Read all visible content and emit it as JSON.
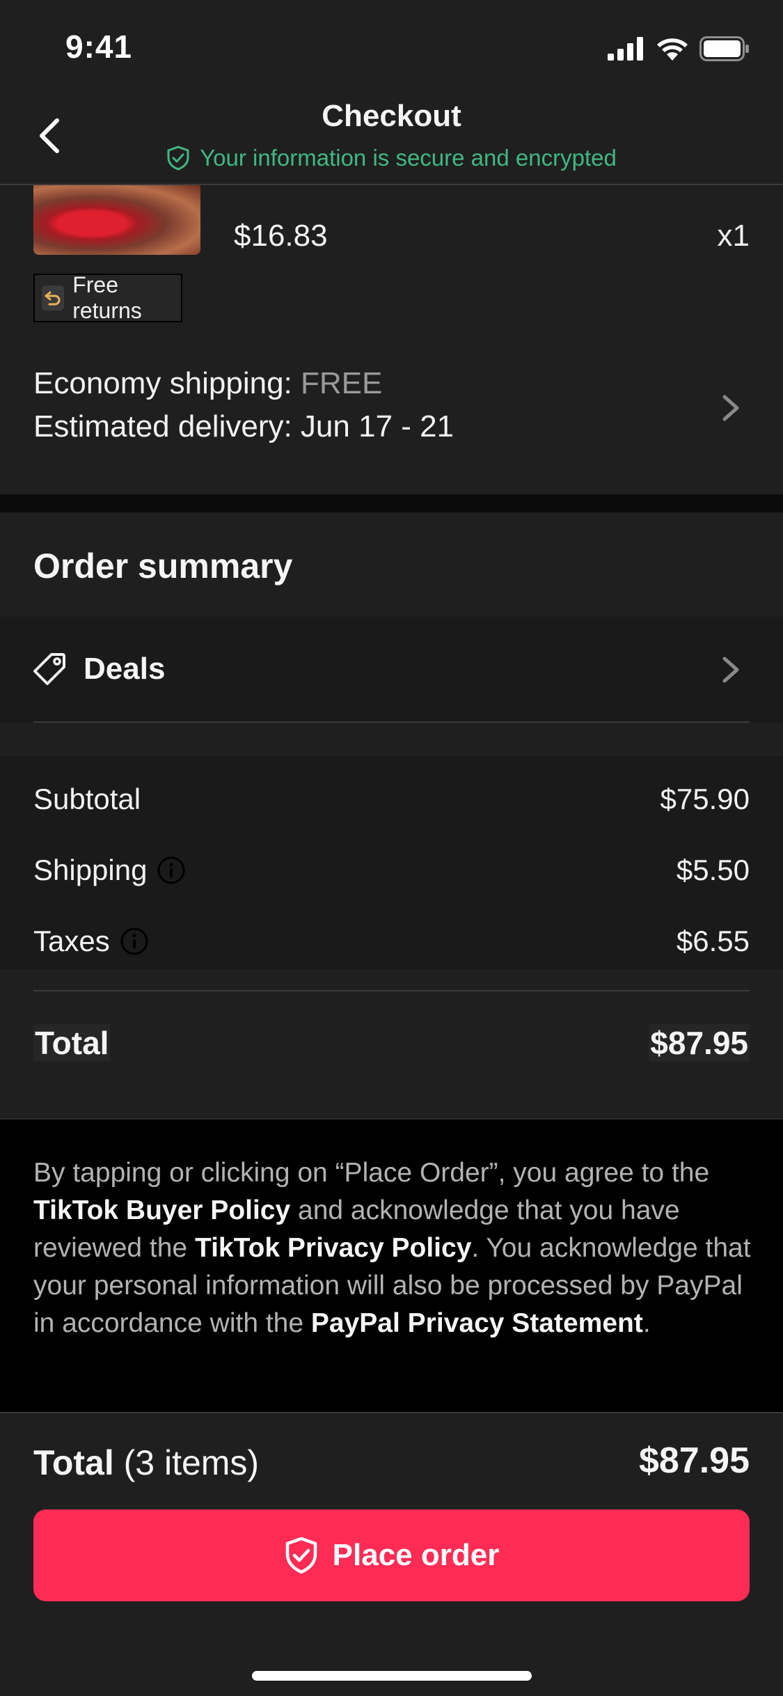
{
  "status_bar": {
    "time": "9:41"
  },
  "header": {
    "title": "Checkout",
    "secure_text": "Your information is secure and encrypted"
  },
  "product": {
    "price": "$16.83",
    "quantity": "x1",
    "free_returns": "Free returns"
  },
  "shipping": {
    "method_label": "Economy shipping",
    "separator": ": ",
    "cost": "FREE",
    "delivery_label": "Estimated delivery: Jun 17 - 21"
  },
  "order_summary": {
    "title": "Order summary",
    "deals_label": "Deals",
    "rows": [
      {
        "label": "Subtotal",
        "value": "$75.90"
      },
      {
        "label": "Shipping",
        "value": "$5.50"
      },
      {
        "label": "Taxes",
        "value": "$6.55"
      }
    ],
    "total_label": "Total",
    "total_value": "$87.95"
  },
  "legal": {
    "part1": "By tapping or clicking on “Place Order”, you agree to the ",
    "buyer_policy": "TikTok Buyer Policy",
    "part2": " and acknowledge that you have reviewed the ",
    "privacy_policy": "TikTok Privacy Policy",
    "part3": ". You acknowledge that your personal information will also be processed by PayPal in accordance with the ",
    "paypal_statement": "PayPal Privacy Statement",
    "part4": "."
  },
  "bottom_bar": {
    "total_label": "Total",
    "items_count": " (3 items)",
    "total_value": "$87.95",
    "place_order_label": "Place order"
  },
  "colors": {
    "accent": "#fe2c55",
    "secure_green": "#41b883",
    "background": "#1f1f1f"
  },
  "icons": [
    "back-arrow-icon",
    "shield-check-icon",
    "return-icon",
    "chevron-right-icon",
    "tag-icon",
    "info-icon",
    "signal-icon",
    "wifi-icon",
    "battery-icon"
  ]
}
